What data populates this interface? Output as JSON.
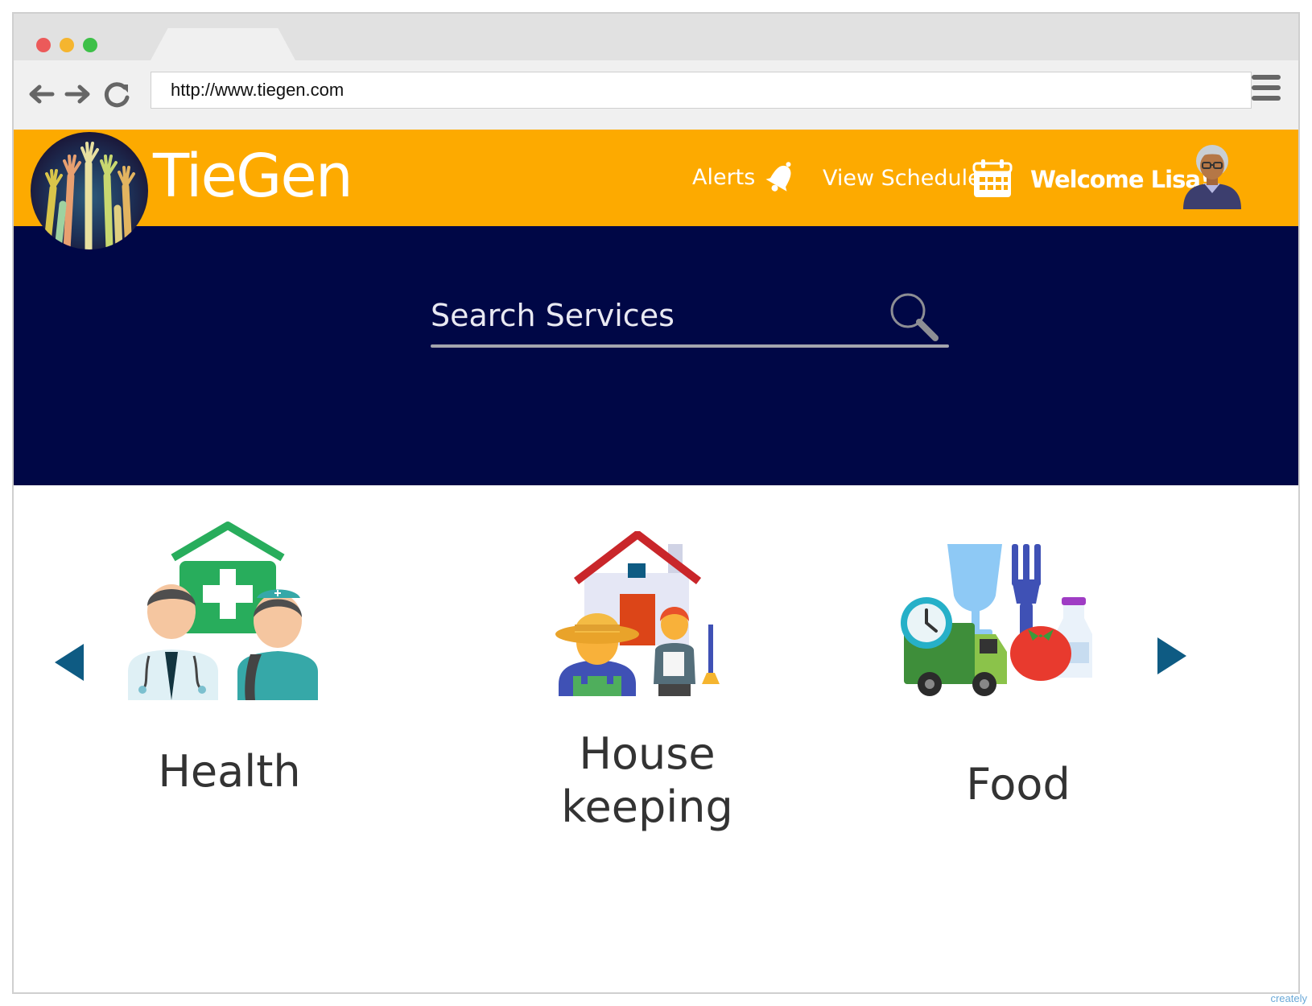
{
  "browser": {
    "url": "http://www.tiegen.com",
    "traffic_lights": [
      "#ec5a5a",
      "#f5b52f",
      "#3dc048"
    ]
  },
  "header": {
    "brand": "TieGen",
    "alerts_label": "Alerts",
    "schedule_label": "View Schedule",
    "welcome_text": "Welcome Lisa!"
  },
  "search": {
    "placeholder": "Search Services"
  },
  "services": [
    {
      "label": "Health",
      "icon": "health-icon"
    },
    {
      "label": "House\nkeeping",
      "icon": "housekeeping-icon"
    },
    {
      "label": "Food",
      "icon": "food-icon"
    }
  ],
  "watermark": "creately",
  "colors": {
    "header": "#fdaa00",
    "hero": "#000746",
    "arrows": "#0e5b83"
  }
}
